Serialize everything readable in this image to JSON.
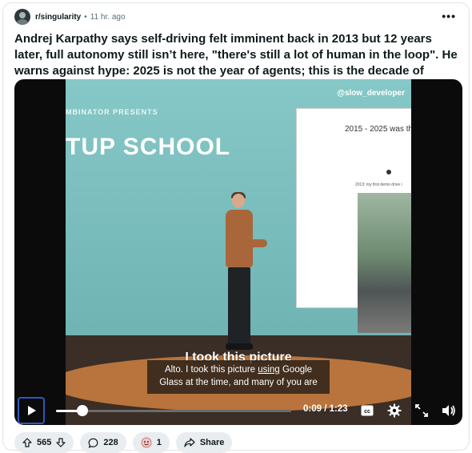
{
  "post": {
    "subreddit": "r/singularity",
    "separator": "•",
    "time_ago": "11 hr. ago",
    "more_label": "•••",
    "title": "Andrej Karpathy says self-driving felt imminent back in 2013 but 12 years later, full autonomy still isn’t here, \"there's still a lot of human in the loop\". He warns against hype: 2025 is not the year of agents; this is the decade of agents"
  },
  "video": {
    "watermark": "@slow_developer",
    "stage_small_text": "MBINATOR PRESENTS",
    "stage_big_text": "TUP SCHOOL",
    "slide_title": "2015 - 2025 was th",
    "slide_subtitle": "2013: my first demo drive i",
    "burned_caption": "I took this picture",
    "caption_line1_pre": "Alto. I took this picture ",
    "caption_line1_underlined": "using",
    "caption_line1_post": " Google",
    "caption_line2": "Glass at the time, and many of you are",
    "current_time": "0:09",
    "duration": "1:23",
    "time_separator": " / ",
    "progress": 0.113,
    "cc_label": "cc"
  },
  "actions": {
    "upvotes": "565",
    "comments": "228",
    "awards": "1",
    "share_label": "Share"
  },
  "colors": {
    "accent_focus": "#2b59c3",
    "pill_bg": "#eaedef",
    "stage_teal": "#7cc0c1",
    "stage_orange": "#b8743c"
  },
  "icons": [
    "avatar",
    "more-icon",
    "play-icon",
    "cc-icon",
    "settings-gear-icon",
    "fullscreen-icon",
    "volume-icon",
    "upvote-icon",
    "downvote-icon",
    "comment-icon",
    "award-icon",
    "share-icon"
  ]
}
